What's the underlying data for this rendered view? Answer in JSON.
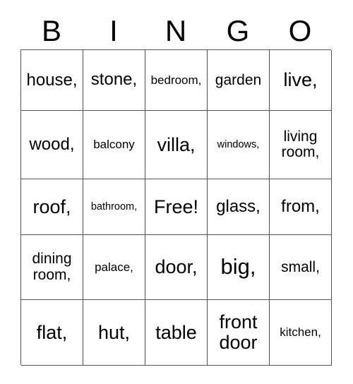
{
  "card": {
    "title": "BINGO",
    "header": [
      "B",
      "I",
      "N",
      "G",
      "O"
    ],
    "free_space_label": "Free!",
    "colors": {
      "text": "#000000",
      "grid_line": "#555555",
      "background": "#ffffff"
    },
    "rows": [
      [
        {
          "text": "house,",
          "size": "lg",
          "wrap": true
        },
        {
          "text": "stone,",
          "size": "lg",
          "wrap": false
        },
        {
          "text": "bedroom,",
          "size": "sm",
          "wrap": false
        },
        {
          "text": "garden",
          "size": "md",
          "wrap": false
        },
        {
          "text": "live,",
          "size": "xl",
          "wrap": false
        }
      ],
      [
        {
          "text": "wood,",
          "size": "lg",
          "wrap": false
        },
        {
          "text": "balcony",
          "size": "sm",
          "wrap": false
        },
        {
          "text": "villa,",
          "size": "xl",
          "wrap": false
        },
        {
          "text": "windows,",
          "size": "xs",
          "wrap": false
        },
        {
          "text": "living room,",
          "size": "md",
          "wrap": true
        }
      ],
      [
        {
          "text": "roof,",
          "size": "xl",
          "wrap": false
        },
        {
          "text": "bathroom,",
          "size": "xs",
          "wrap": false
        },
        {
          "text": "Free!",
          "size": "xl",
          "wrap": false
        },
        {
          "text": "glass,",
          "size": "lg",
          "wrap": false
        },
        {
          "text": "from,",
          "size": "lg",
          "wrap": false
        }
      ],
      [
        {
          "text": "dining room,",
          "size": "md",
          "wrap": true
        },
        {
          "text": "palace,",
          "size": "sm",
          "wrap": false
        },
        {
          "text": "door,",
          "size": "xl",
          "wrap": false
        },
        {
          "text": "big,",
          "size": "xxl",
          "wrap": false
        },
        {
          "text": "small,",
          "size": "md",
          "wrap": false
        }
      ],
      [
        {
          "text": "flat,",
          "size": "xl",
          "wrap": false
        },
        {
          "text": "hut,",
          "size": "xl",
          "wrap": false
        },
        {
          "text": "table",
          "size": "xl",
          "wrap": false
        },
        {
          "text": "front door",
          "size": "xl",
          "wrap": true
        },
        {
          "text": "kitchen,",
          "size": "sm",
          "wrap": false
        }
      ]
    ]
  }
}
